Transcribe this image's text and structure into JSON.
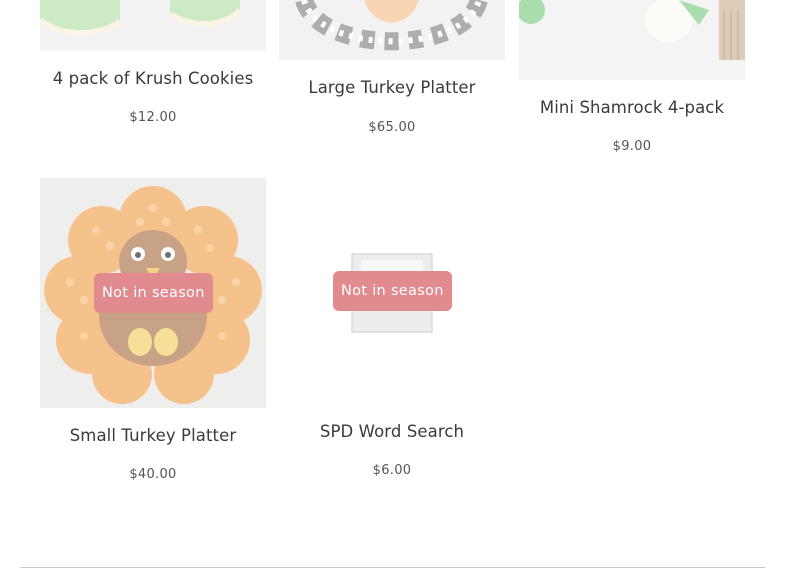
{
  "products": [
    {
      "name": "4 pack of Krush Cookies",
      "price": "$12.00"
    },
    {
      "name": "Large Turkey Platter",
      "price": "$65.00"
    },
    {
      "name": "Mini Shamrock 4-pack",
      "price": "$9.00"
    },
    {
      "name": "Small Turkey Platter",
      "price": "$40.00",
      "badge": "Not in season"
    },
    {
      "name": "SPD Word Search",
      "price": "$6.00",
      "badge": "Not in season"
    }
  ],
  "colors": {
    "badge_bg": "#e28b8f",
    "badge_text": "#ffffff",
    "image_fade": "#ffffff"
  }
}
